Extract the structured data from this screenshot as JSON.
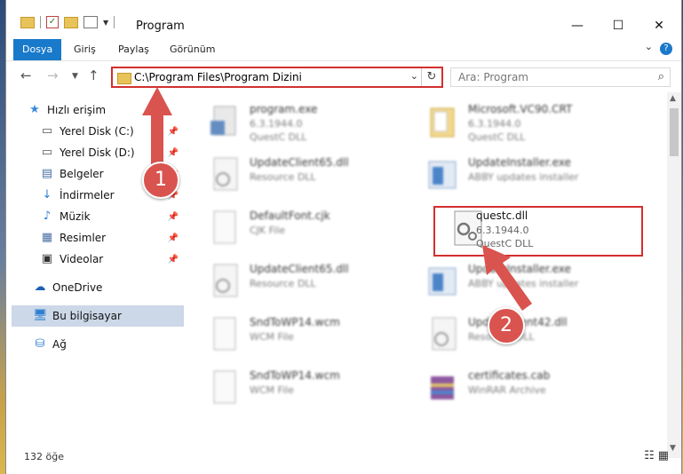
{
  "window": {
    "title": "Program",
    "minimize": "—",
    "maximize": "☐",
    "close": "✕"
  },
  "ribbon": {
    "tabs": [
      "Dosya",
      "Giriş",
      "Paylaş",
      "Görünüm"
    ],
    "help": "?"
  },
  "address": {
    "path": "C:\\Program Files\\Program Dizini"
  },
  "search": {
    "placeholder": "Ara: Program"
  },
  "nav": {
    "items": [
      {
        "label": "Hızlı erişim",
        "icon": "star-icon"
      },
      {
        "label": "Yerel Disk (C:)",
        "icon": "drive-icon"
      },
      {
        "label": "Yerel Disk (D:)",
        "icon": "drive-icon"
      },
      {
        "label": "Belgeler",
        "icon": "documents-icon"
      },
      {
        "label": "İndirmeler",
        "icon": "download-icon"
      },
      {
        "label": "Müzik",
        "icon": "music-icon"
      },
      {
        "label": "Resimler",
        "icon": "pictures-icon"
      },
      {
        "label": "Videolar",
        "icon": "videos-icon"
      },
      {
        "label": "OneDrive",
        "icon": "cloud-icon"
      },
      {
        "label": "Bu bilgisayar",
        "icon": "computer-icon"
      },
      {
        "label": "Ağ",
        "icon": "network-icon"
      }
    ]
  },
  "files": [
    {
      "name": "program.exe",
      "l2": "6.3.1944.0",
      "l3": "QuestC DLL"
    },
    {
      "name": "Microsoft.VC90.CRT",
      "l2": "6.3.1944.0",
      "l3": "QuestC DLL"
    },
    {
      "name": "UpdateClient65.dll",
      "l2": "Resource DLL",
      "l3": ""
    },
    {
      "name": "UpdateInstaller.exe",
      "l2": "ABBY updates installer",
      "l3": ""
    },
    {
      "name": "DefaultFont.cjk",
      "l2": "CJK File",
      "l3": ""
    },
    {
      "name": "questc.dll",
      "l2": "6.3.1944.0",
      "l3": "QuestC DLL"
    },
    {
      "name": "UpdateClient65.dll",
      "l2": "Resource DLL",
      "l3": ""
    },
    {
      "name": "UpdateInstaller.exe",
      "l2": "ABBY updates installer",
      "l3": ""
    },
    {
      "name": "SndToWP14.wcm",
      "l2": "WCM File",
      "l3": ""
    },
    {
      "name": "UpdateClient42.dll",
      "l2": "Resource DLL",
      "l3": ""
    },
    {
      "name": "SndToWP14.wcm",
      "l2": "WCM File",
      "l3": ""
    },
    {
      "name": "certificates.cab",
      "l2": "WinRAR Archive",
      "l3": ""
    }
  ],
  "status": {
    "count": "132 öğe"
  },
  "annotations": [
    "1",
    "2"
  ]
}
